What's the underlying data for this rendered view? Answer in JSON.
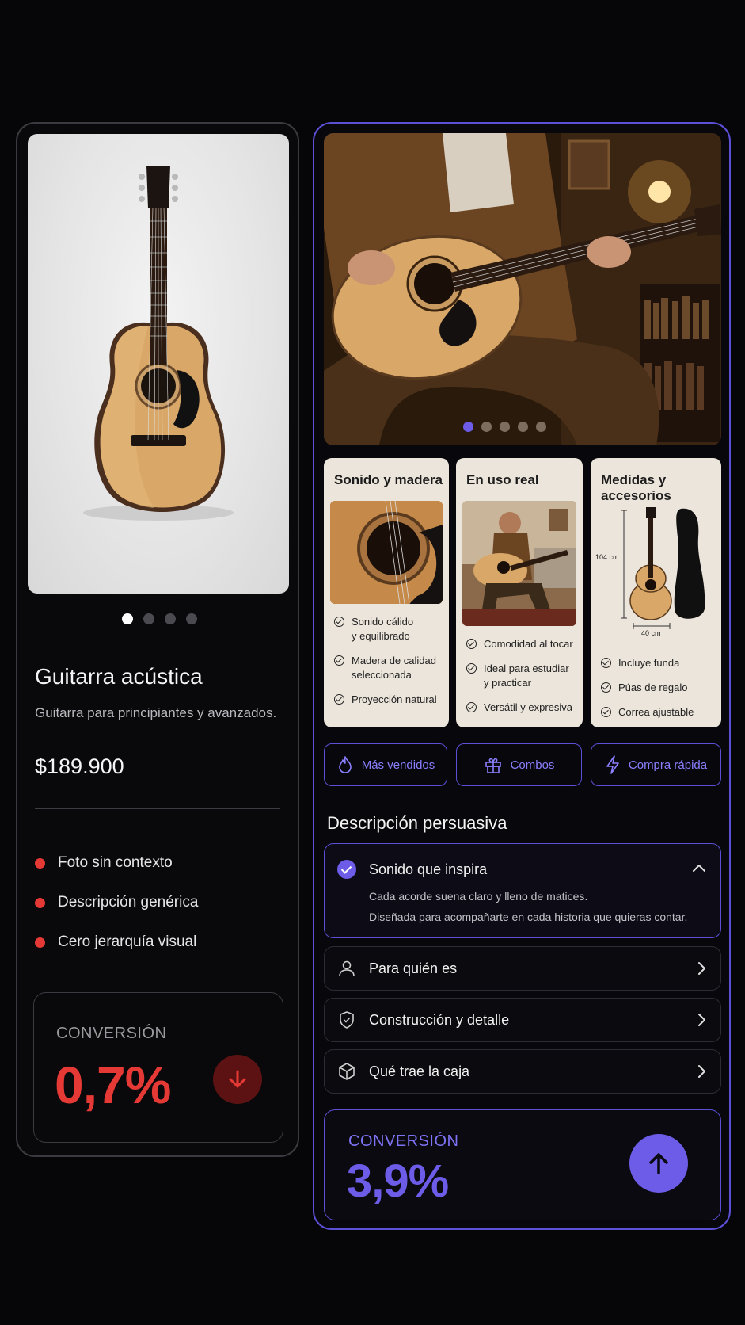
{
  "before": {
    "carousel": {
      "total": 4,
      "active": 1
    },
    "product_title": "Guitarra acústica",
    "product_subtitle": "Guitarra para principiantes y avanzados.",
    "price": "$189.900",
    "issues": [
      "Foto sin contexto",
      "Descripción genérica",
      "Cero jerarquía visual"
    ],
    "conversion": {
      "label": "CONVERSIÓN",
      "value": "0,7%",
      "trend": "down"
    }
  },
  "after": {
    "carousel": {
      "total": 5,
      "active": 1
    },
    "feature_cards": [
      {
        "title": "Sonido y madera",
        "items": [
          "Sonido cálido\ny equilibrado",
          "Madera de calidad\nseleccionada",
          "Proyección natural"
        ]
      },
      {
        "title": "En uso real",
        "items": [
          "Comodidad al tocar",
          "Ideal para estudiar\ny practicar",
          "Versátil y expresiva"
        ]
      },
      {
        "title": "Medidas y\naccesorios",
        "dimensions": {
          "height": "104 cm",
          "width": "40 cm"
        },
        "items": [
          "Incluye funda",
          "Púas de regalo",
          "Correa ajustable"
        ]
      }
    ],
    "chips": [
      {
        "label": "Más vendidos",
        "icon": "flame-icon"
      },
      {
        "label": "Combos",
        "icon": "gift-icon"
      },
      {
        "label": "Compra rápida",
        "icon": "lightning-icon"
      }
    ],
    "description_title": "Descripción persuasiva",
    "accordion_open": {
      "title": "Sonido que inspira",
      "line1": "Cada acorde suena claro y lleno de matices.",
      "line2": "Diseñada para acompañarte en cada historia que quieras contar."
    },
    "accordion_items": [
      {
        "label": "Para quién es",
        "icon": "user-icon"
      },
      {
        "label": "Construcción y detalle",
        "icon": "shield-icon"
      },
      {
        "label": "Qué trae la caja",
        "icon": "box-icon"
      }
    ],
    "conversion": {
      "label": "CONVERSIÓN",
      "value": "3,9%",
      "trend": "up"
    }
  },
  "colors": {
    "accent": "#6c5ce7",
    "negative": "#e53935",
    "card_beige": "#ece5db",
    "background": "#060608"
  }
}
